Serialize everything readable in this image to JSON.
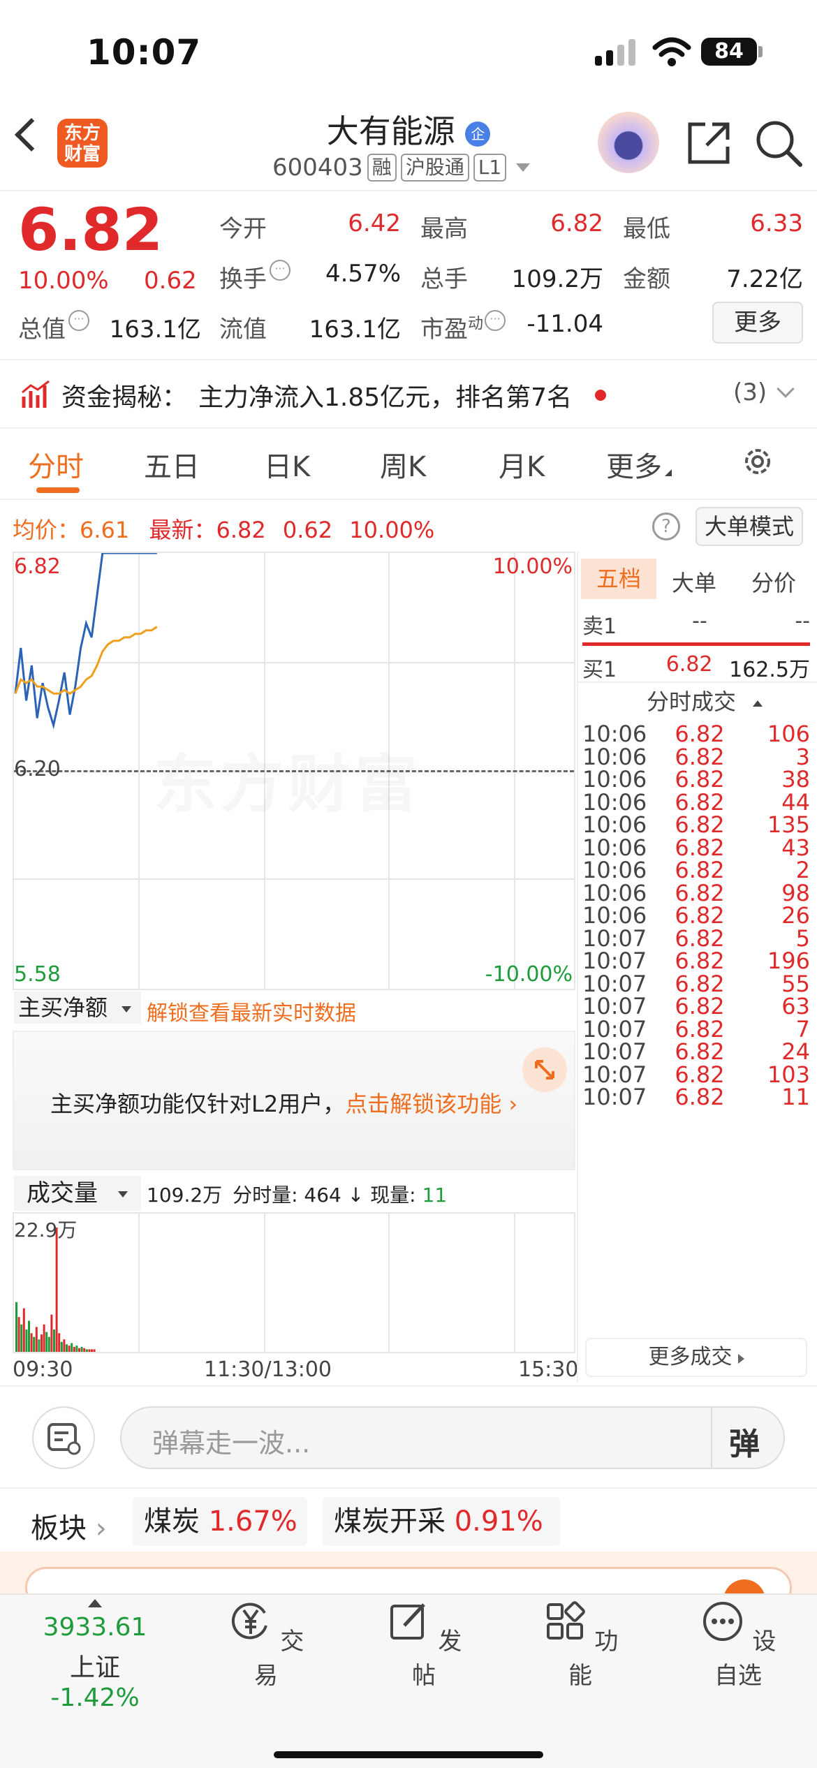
{
  "status_bar": {
    "time": "10:07",
    "battery": "84"
  },
  "header": {
    "logo_text": "东方财富",
    "stock_name": "大有能源",
    "badge": "企",
    "code": "600403",
    "tags": [
      "融",
      "沪股通",
      "L1"
    ]
  },
  "quote": {
    "price": "6.82",
    "change_pct": "10.00%",
    "change_amt": "0.62",
    "fields": {
      "open_label": "今开",
      "open": "6.42",
      "high_label": "最高",
      "high": "6.82",
      "low_label": "最低",
      "low": "6.33",
      "turnover_label": "换手",
      "turnover": "4.57%",
      "volume_label": "总手",
      "volume": "109.2万",
      "amount_label": "金额",
      "amount": "7.22亿",
      "mcap_label": "总值",
      "mcap": "163.1亿",
      "float_label": "流值",
      "float": "163.1亿",
      "pe_label": "市盈",
      "pe_sup": "动",
      "pe": "-11.04"
    },
    "more_button": "更多"
  },
  "fund_banner": {
    "label": "资金揭秘：",
    "text": "主力净流入1.85亿元，排名第7名",
    "count": "(3)"
  },
  "tabs": [
    "分时",
    "五日",
    "日K",
    "周K",
    "月K",
    "更多"
  ],
  "chart_info": {
    "avg_label": "均价：",
    "avg": "6.61",
    "latest_label": "最新：",
    "latest": "6.82",
    "latest_chg": "0.62",
    "latest_pct": "10.00%",
    "mode_button": "大单模式"
  },
  "chart_data": {
    "type": "line",
    "y_labels": {
      "top": "6.82",
      "mid": "6.20",
      "bottom": "5.58",
      "top_pct": "10.00%",
      "bottom_pct": "-10.00%"
    },
    "ylim": [
      5.58,
      6.82
    ],
    "x_labels": [
      "09:30",
      "11:30/13:00",
      "15:30"
    ],
    "series": [
      {
        "values": [
          6.42,
          6.55,
          6.4,
          6.5,
          6.35,
          6.45,
          6.38,
          6.33,
          6.4,
          6.48,
          6.36,
          6.44,
          6.55,
          6.62,
          6.58,
          6.7,
          6.82,
          6.82,
          6.82,
          6.82,
          6.82,
          6.82,
          6.82,
          6.82,
          6.82,
          6.82,
          6.82
        ]
      },
      {
        "values": [
          6.42,
          6.46,
          6.45,
          6.46,
          6.44,
          6.44,
          6.43,
          6.42,
          6.42,
          6.43,
          6.42,
          6.43,
          6.44,
          6.46,
          6.47,
          6.5,
          6.54,
          6.56,
          6.57,
          6.57,
          6.58,
          6.58,
          6.59,
          6.59,
          6.6,
          6.6,
          6.61
        ]
      }
    ],
    "volume_max_label": "22.9万",
    "volume_bars": [
      0.4,
      0.28,
      0.22,
      0.35,
      0.18,
      0.25,
      0.15,
      0.12,
      0.2,
      0.1,
      0.14,
      0.22,
      0.16,
      0.12,
      0.3,
      0.18,
      1.0,
      0.15,
      0.08,
      0.1,
      0.06,
      0.05,
      0.07,
      0.04,
      0.05,
      0.03,
      0.04,
      0.03,
      0.02,
      0.02,
      0.02,
      0.02
    ],
    "volume_up": [
      false,
      true,
      false,
      true,
      false,
      false,
      true,
      false,
      true,
      false,
      true,
      true,
      false,
      false,
      true,
      false,
      true,
      true,
      false,
      true,
      false,
      true,
      false,
      true,
      false,
      true,
      false,
      true,
      false,
      true,
      true,
      true
    ]
  },
  "net_buy": {
    "dropdown": "主买净额",
    "unlock_link": "解锁查看最新实时数据",
    "notice": "主买净额功能仅针对L2用户，",
    "notice_link": "点击解锁该功能"
  },
  "volume_bar": {
    "dropdown": "成交量",
    "total": "109.2万",
    "period_label": "分时量:",
    "period": "464",
    "current_label": "现量:",
    "current": "11"
  },
  "order_book": {
    "tabs": [
      "五档",
      "大单",
      "分价"
    ],
    "ask": {
      "label": "卖1",
      "price": "--",
      "vol": "--"
    },
    "bid": {
      "label": "买1",
      "price": "6.82",
      "vol": "162.5万"
    },
    "trades_header": "分时成交",
    "trades": [
      {
        "t": "10:06",
        "p": "6.82",
        "v": "106"
      },
      {
        "t": "10:06",
        "p": "6.82",
        "v": "3"
      },
      {
        "t": "10:06",
        "p": "6.82",
        "v": "38"
      },
      {
        "t": "10:06",
        "p": "6.82",
        "v": "44"
      },
      {
        "t": "10:06",
        "p": "6.82",
        "v": "135"
      },
      {
        "t": "10:06",
        "p": "6.82",
        "v": "43"
      },
      {
        "t": "10:06",
        "p": "6.82",
        "v": "2"
      },
      {
        "t": "10:06",
        "p": "6.82",
        "v": "98"
      },
      {
        "t": "10:06",
        "p": "6.82",
        "v": "26"
      },
      {
        "t": "10:07",
        "p": "6.82",
        "v": "5"
      },
      {
        "t": "10:07",
        "p": "6.82",
        "v": "196"
      },
      {
        "t": "10:07",
        "p": "6.82",
        "v": "55"
      },
      {
        "t": "10:07",
        "p": "6.82",
        "v": "63"
      },
      {
        "t": "10:07",
        "p": "6.82",
        "v": "7"
      },
      {
        "t": "10:07",
        "p": "6.82",
        "v": "24"
      },
      {
        "t": "10:07",
        "p": "6.82",
        "v": "103"
      },
      {
        "t": "10:07",
        "p": "6.82",
        "v": "11"
      }
    ],
    "more_trades": "更多成交"
  },
  "danmu": {
    "placeholder": "弹幕走一波...",
    "button": "弹"
  },
  "sectors": {
    "label": "板块",
    "items": [
      {
        "name": "煤炭",
        "pct": "1.67%"
      },
      {
        "name": "煤炭开采",
        "pct": "0.91%"
      }
    ]
  },
  "bottom_nav": {
    "index_value": "3933.61",
    "index_name": "上证",
    "index_pct": "-1.42%",
    "items": [
      "交易",
      "发帖",
      "功能",
      "设自选"
    ]
  }
}
